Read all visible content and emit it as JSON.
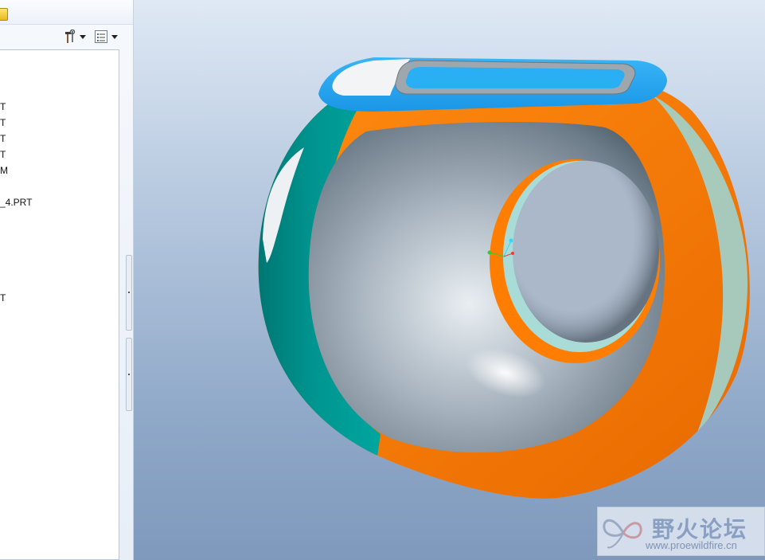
{
  "tree": {
    "items": [
      "T",
      "T",
      "T",
      "T",
      "M",
      "_4.PRT",
      "T"
    ]
  },
  "toolbar": {
    "settings_icon": "hammer-wrench-icon",
    "show_icon": "list-icon"
  },
  "watermark": {
    "title": "野火论坛",
    "url": "www.proewildfire.cn"
  },
  "colors": {
    "viewport_top": "#dfe9f5",
    "viewport_bottom": "#7f99bd",
    "orange": "#ff7d00",
    "teal": "#009790",
    "blue": "#25a9f0",
    "gray": "#a7b3be"
  }
}
